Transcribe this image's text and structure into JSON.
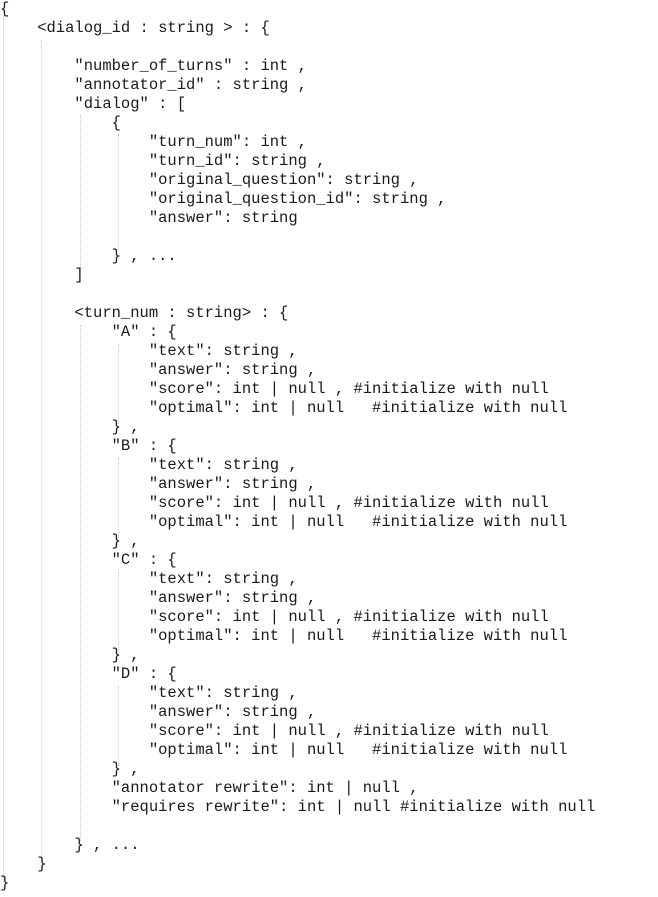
{
  "lines": [
    "{",
    "    <dialog_id : string > : {",
    "",
    "        \"number_of_turns\" : int ,",
    "        \"annotator_id\" : string ,",
    "        \"dialog\" : [",
    "            {",
    "                \"turn_num\": int ,",
    "                \"turn_id\": string ,",
    "                \"original_question\": string ,",
    "                \"original_question_id\": string ,",
    "                \"answer\": string",
    "",
    "            } , ...",
    "        ]",
    "",
    "        <turn_num : string> : {",
    "            \"A\" : {",
    "                \"text\": string ,",
    "                \"answer\": string ,",
    "                \"score\": int | null , #initialize with null",
    "                \"optimal\": int | null   #initialize with null",
    "            } ,",
    "            \"B\" : {",
    "                \"text\": string ,",
    "                \"answer\": string ,",
    "                \"score\": int | null , #initialize with null",
    "                \"optimal\": int | null   #initialize with null",
    "            } ,",
    "            \"C\" : {",
    "                \"text\": string ,",
    "                \"answer\": string ,",
    "                \"score\": int | null , #initialize with null",
    "                \"optimal\": int | null   #initialize with null",
    "            } ,",
    "            \"D\" : {",
    "                \"text\": string ,",
    "                \"answer\": string ,",
    "                \"score\": int | null , #initialize with null",
    "                \"optimal\": int | null   #initialize with null",
    "            } ,",
    "            \"annotator rewrite\": int | null ,",
    "            \"requires rewrite\": int | null #initialize with null",
    "",
    "        } , ...",
    "    }",
    "}"
  ]
}
